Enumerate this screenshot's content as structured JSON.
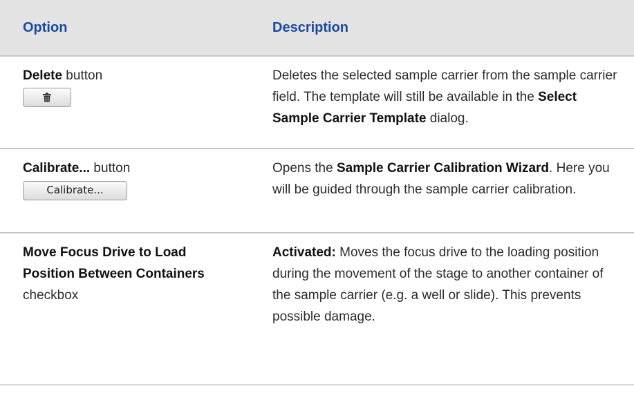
{
  "table": {
    "headers": {
      "option": "Option",
      "description": "Description"
    },
    "rows": [
      {
        "option_bold": "Delete",
        "option_suffix": " button",
        "button_icon": "trash-icon",
        "desc_1": "Deletes the selected sample carrier from the sample carrier field. The template will still be available in the ",
        "desc_bold_1": "Select Sample Carrier Template",
        "desc_2": " dialog."
      },
      {
        "option_bold": "Calibrate...",
        "option_suffix": " button",
        "button_label": "Calibrate...",
        "desc_1": "Opens the ",
        "desc_bold_1": "Sample Carrier Calibration Wizard",
        "desc_2": ". Here you will be guided through the sample carrier calibration."
      },
      {
        "option_bold": "Move Focus Drive to Load Position Between Containers",
        "option_suffix": " checkbox",
        "desc_bold_1": "Activated:",
        "desc_2": " Moves the focus drive to the loading position during the movement of the stage to another container of the sample carrier (e.g. a well or slide). This prevents possible damage."
      }
    ]
  },
  "colors": {
    "header_text": "#1a4aa0",
    "header_bg": "#e3e3e3",
    "divider": "#c6c6c6"
  }
}
